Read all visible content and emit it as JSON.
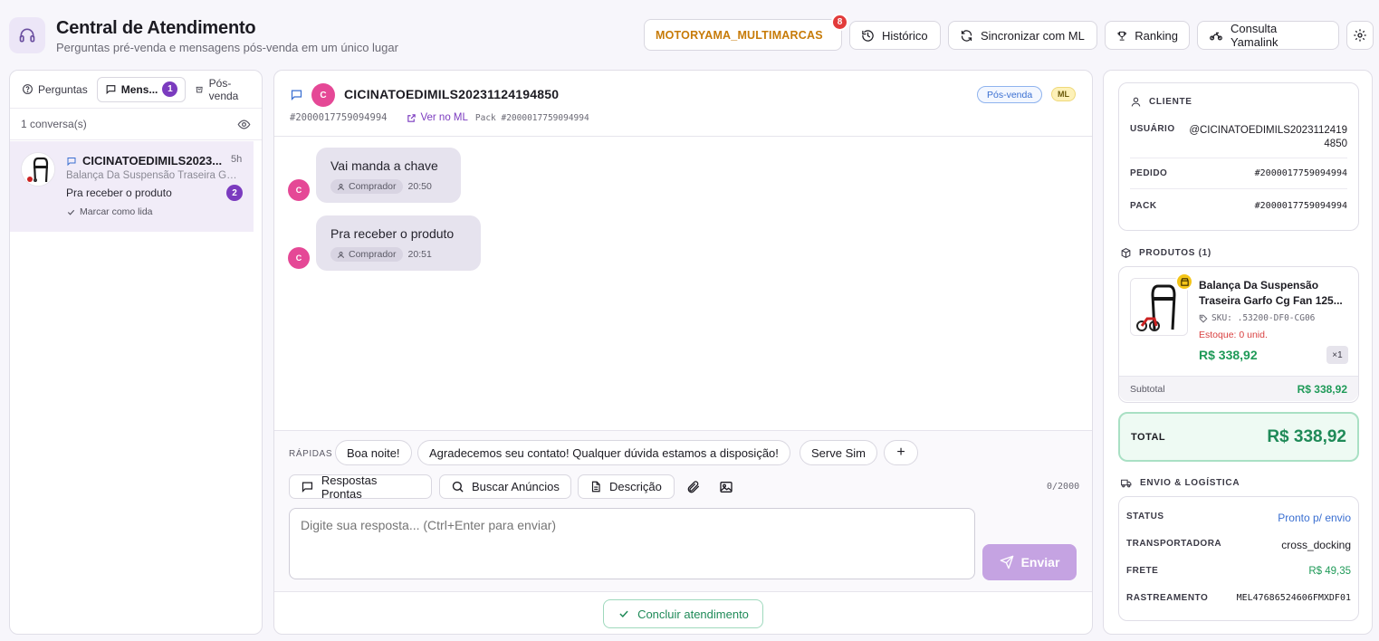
{
  "header": {
    "title": "Central de Atendimento",
    "subtitle": "Perguntas pré-venda e mensagens pós-venda em um único lugar",
    "store": "MOTORYAMA_MULTIMARCAS",
    "store_badge": "8",
    "buttons": {
      "historico": "Histórico",
      "sync": "Sincronizar com ML",
      "ranking": "Ranking",
      "yamalink": "Consulta Yamalink"
    }
  },
  "left": {
    "tabs": [
      {
        "label": "Perguntas"
      },
      {
        "label": "Mens...",
        "count": "1"
      },
      {
        "label": "Pós-venda"
      }
    ],
    "conv_count": "1 conversa(s)",
    "conversation": {
      "name": "CICINATOEDIMILS2023...",
      "time": "5h",
      "product": "Balança Da Suspensão Traseira Garfo Cg Fan 125...",
      "last_message": "Pra receber o produto",
      "unread": "2",
      "mark_read": "Marcar como lida"
    }
  },
  "chat": {
    "avatar_letter": "C",
    "name": "CICINATOEDIMILS20231124194850",
    "order_id": "#2000017759094994",
    "ver_ml": "Ver no ML",
    "pack": "Pack #2000017759094994",
    "type_pill": "Pós-venda",
    "ml_pill": "ML",
    "messages": [
      {
        "text": "Vai manda a chave",
        "who": "Comprador",
        "time": "20:50"
      },
      {
        "text": "Pra receber o produto",
        "who": "Comprador",
        "time": "20:51"
      }
    ],
    "rapidas_label": "RÁPIDAS",
    "chips": [
      "Boa noite!",
      "Agradecemos seu contato! Qualquer dúvida estamos a disposição!",
      "Serve Sim",
      "+"
    ],
    "tools": {
      "respostas": "Respostas Prontas",
      "buscar": "Buscar Anúncios",
      "descricao": "Descrição"
    },
    "counter": "0/2000",
    "placeholder": "Digite sua resposta... (Ctrl+Enter para enviar)",
    "send": "Enviar",
    "conclude": "Concluir atendimento"
  },
  "right": {
    "cliente": {
      "title": "CLIENTE",
      "usuario_k": "USUÁRIO",
      "usuario_v1": "@CICINATOEDIMILS2023112419",
      "usuario_v2": "4850",
      "pedido_k": "PEDIDO",
      "pedido_v": "#2000017759094994",
      "pack_k": "PACK",
      "pack_v": "#2000017759094994"
    },
    "produtos": {
      "title": "PRODUTOS (1)",
      "name_line1": "Balança Da Suspensão",
      "name_line2": "Traseira Garfo Cg Fan 125...",
      "sku": "SKU: .53200-DF0-CG06",
      "stock": "Estoque: 0 unid.",
      "price": "R$ 338,92",
      "qty": "×1",
      "subtotal_k": "Subtotal",
      "subtotal_v": "R$ 338,92"
    },
    "total_k": "TOTAL",
    "total_v": "R$ 338,92",
    "envio": {
      "title": "ENVIO & LOGÍSTICA",
      "status_k": "STATUS",
      "status_v": "Pronto p/ envio",
      "transp_k": "TRANSPORTADORA",
      "transp_v": "cross_docking",
      "frete_k": "FRETE",
      "frete_v": "R$ 49,35",
      "rastreio_k": "RASTREAMENTO",
      "rastreio_v": "MEL47686524606FMXDF01"
    }
  },
  "colors": {
    "accent": "#7b3bbf",
    "avatar": "#e54896",
    "green": "#1f9a58",
    "store": "#c77b08"
  }
}
